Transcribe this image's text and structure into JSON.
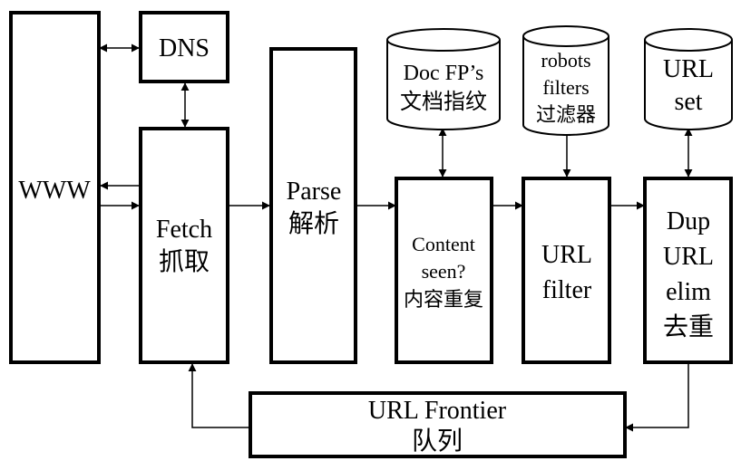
{
  "diagram": {
    "www": "WWW",
    "dns": "DNS",
    "fetch": {
      "line1": "Fetch",
      "line2": "抓取"
    },
    "parse": {
      "line1": "Parse",
      "line2": "解析"
    },
    "content_seen": {
      "line1": "Content",
      "line2": "seen?",
      "line3": "内容重复"
    },
    "url_filter": {
      "line1": "URL",
      "line2": "filter"
    },
    "dup_url_elim": {
      "line1": "Dup",
      "line2": "URL",
      "line3": "elim",
      "line4": "去重"
    },
    "doc_fps": {
      "line1": "Doc FP’s",
      "line2": "文档指纹"
    },
    "robots_filters": {
      "line1": "robots",
      "line2": "filters",
      "line3": "过滤器"
    },
    "url_set": {
      "line1": "URL",
      "line2": "set"
    },
    "url_frontier": {
      "line1": "URL Frontier",
      "line2": "队列"
    }
  }
}
